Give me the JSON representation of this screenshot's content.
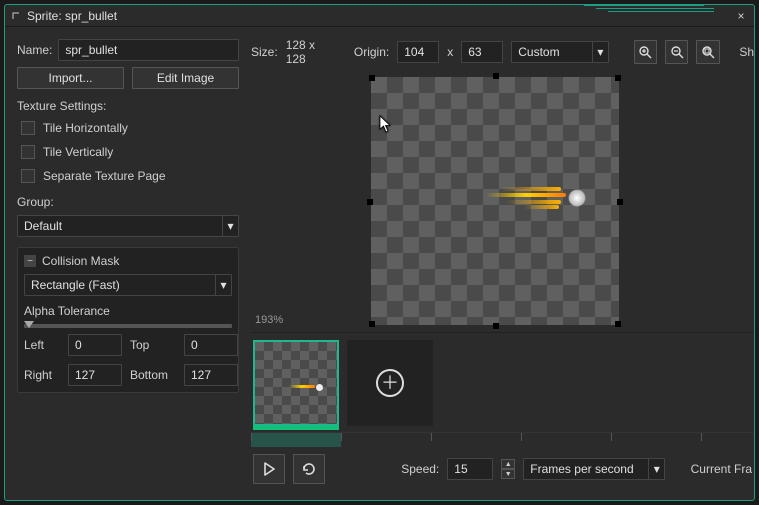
{
  "window": {
    "title": "Sprite: spr_bullet"
  },
  "left_panel": {
    "name_label": "Name:",
    "name_value": "spr_bullet",
    "import_btn": "Import...",
    "edit_image_btn": "Edit Image",
    "texture_settings_label": "Texture Settings:",
    "tile_h": "Tile Horizontally",
    "tile_v": "Tile Vertically",
    "sep_page": "Separate Texture Page",
    "group_label": "Group:",
    "group_value": "Default",
    "collision_mask_label": "Collision Mask",
    "mask_shape": "Rectangle (Fast)",
    "alpha_tol": "Alpha Tolerance",
    "left_label": "Left",
    "left_val": "0",
    "top_label": "Top",
    "top_val": "0",
    "right_label": "Right",
    "right_val": "127",
    "bottom_label": "Bottom",
    "bottom_val": "127"
  },
  "top": {
    "size_label": "Size:",
    "size_value": "128 x 128",
    "origin_label": "Origin:",
    "origin_x": "104",
    "origin_sep": "x",
    "origin_y": "63",
    "origin_mode": "Custom",
    "sh_cut": "Sh"
  },
  "canvas": {
    "zoom": "193%"
  },
  "bottom": {
    "speed_label": "Speed:",
    "speed_value": "15",
    "speed_unit": "Frames per second",
    "current_frame_cut": "Current Fra"
  }
}
